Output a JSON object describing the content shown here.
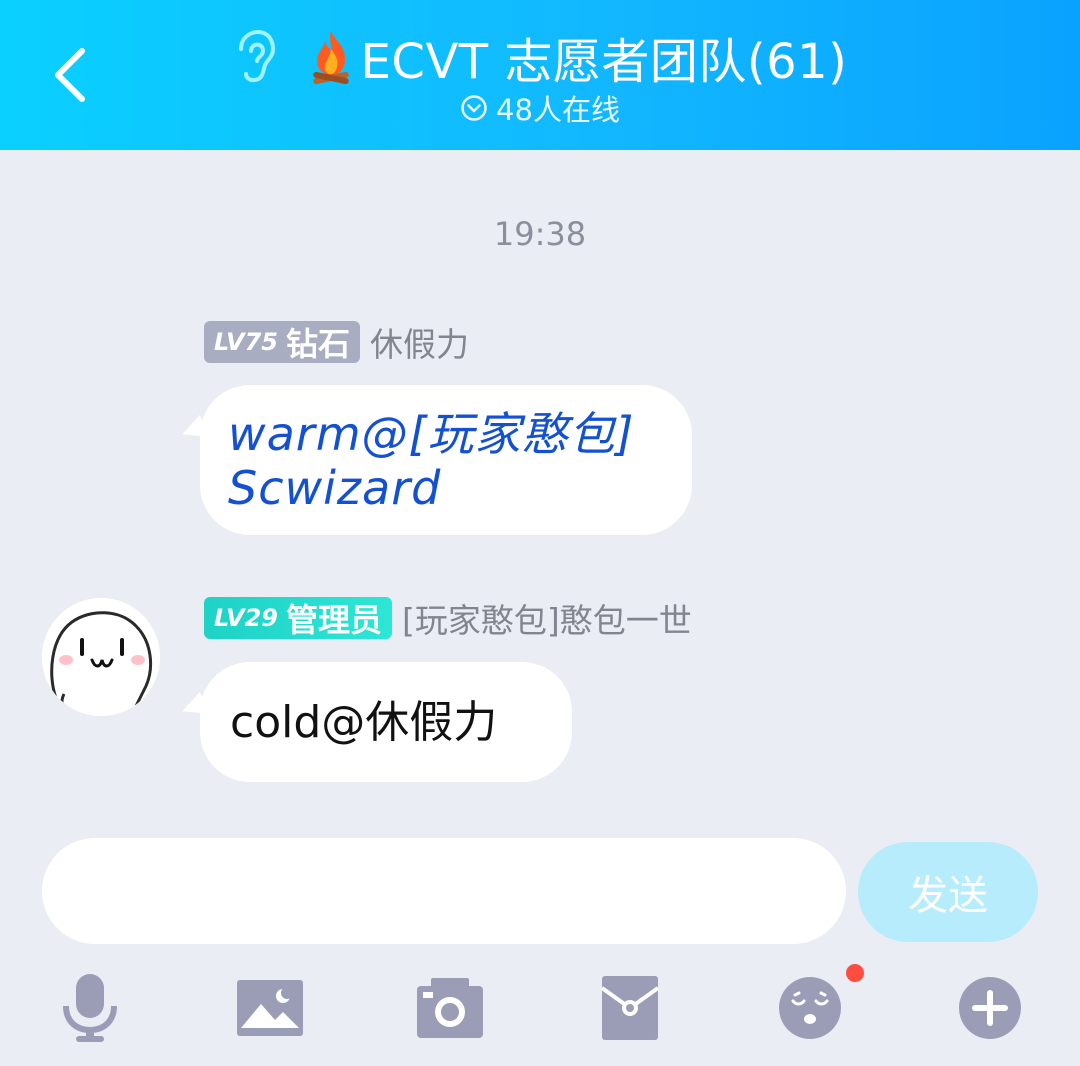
{
  "header": {
    "title": "ECVT 志愿者团队(61)",
    "online_text": "48人在线"
  },
  "colors": {
    "header_start": "#0ad0ff",
    "header_end": "#0aa2ff",
    "background": "#ebedf5",
    "admin_badge": "#1ed2c6",
    "diamond_badge": "#a9adc2",
    "send_button": "#b7ecfd",
    "fancy_text": "#1450d2",
    "notification_dot": "#ff4d40"
  },
  "chat": {
    "timestamp": "19:38",
    "messages": [
      {
        "level": "LV75",
        "rank": "钻石",
        "sender": "休假力",
        "text": "warm@[玩家憨包] Scwizard"
      },
      {
        "level": "LV29",
        "rank": "管理员",
        "sender": "[玩家憨包]憨包一世",
        "text": "cold@休假力"
      }
    ]
  },
  "input": {
    "placeholder": "",
    "value": "",
    "send_label": "发送"
  },
  "toolbar": {
    "icons": [
      "microphone-icon",
      "image-icon",
      "camera-icon",
      "red-packet-icon",
      "emoji-icon",
      "plus-icon"
    ]
  }
}
